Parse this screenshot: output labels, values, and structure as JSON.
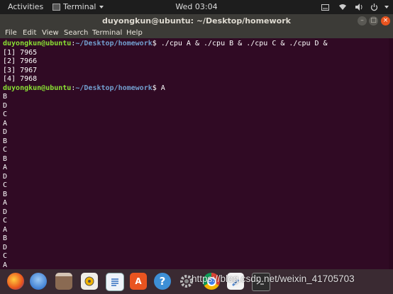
{
  "top_panel": {
    "activities": "Activities",
    "app_name": "Terminal",
    "clock": "Wed 03:04"
  },
  "window": {
    "title": "duyongkun@ubuntu: ~/Desktop/homework"
  },
  "menu": {
    "items": [
      "File",
      "Edit",
      "View",
      "Search",
      "Terminal",
      "Help"
    ]
  },
  "terminal": {
    "prompt_user": "duyongkun@ubuntu",
    "prompt_sep": ":",
    "prompt_path": "~/Desktop/homework",
    "prompt_end": "$ ",
    "command_1": "./cpu A & ./cpu B & ./cpu C & ./cpu D &",
    "jobs": [
      "[1] 7965",
      "[2] 7966",
      "[3] 7967",
      "[4] 7968"
    ],
    "command_2": "A",
    "output": [
      "B",
      "D",
      "C",
      "A",
      "D",
      "B",
      "C",
      "B",
      "A",
      "D",
      "C",
      "B",
      "A",
      "D",
      "C",
      "A",
      "B",
      "D",
      "C",
      "A"
    ]
  },
  "dock": {
    "icons": [
      "firefox-icon",
      "thunderbird-icon",
      "files-icon",
      "rhythmbox-icon",
      "writer-icon",
      "software-center-icon",
      "help-icon",
      "settings-icon",
      "chrome-icon",
      "editor-icon",
      "terminal-icon"
    ]
  },
  "watermark": "https://blog.csdn.net/weixin_41705703"
}
